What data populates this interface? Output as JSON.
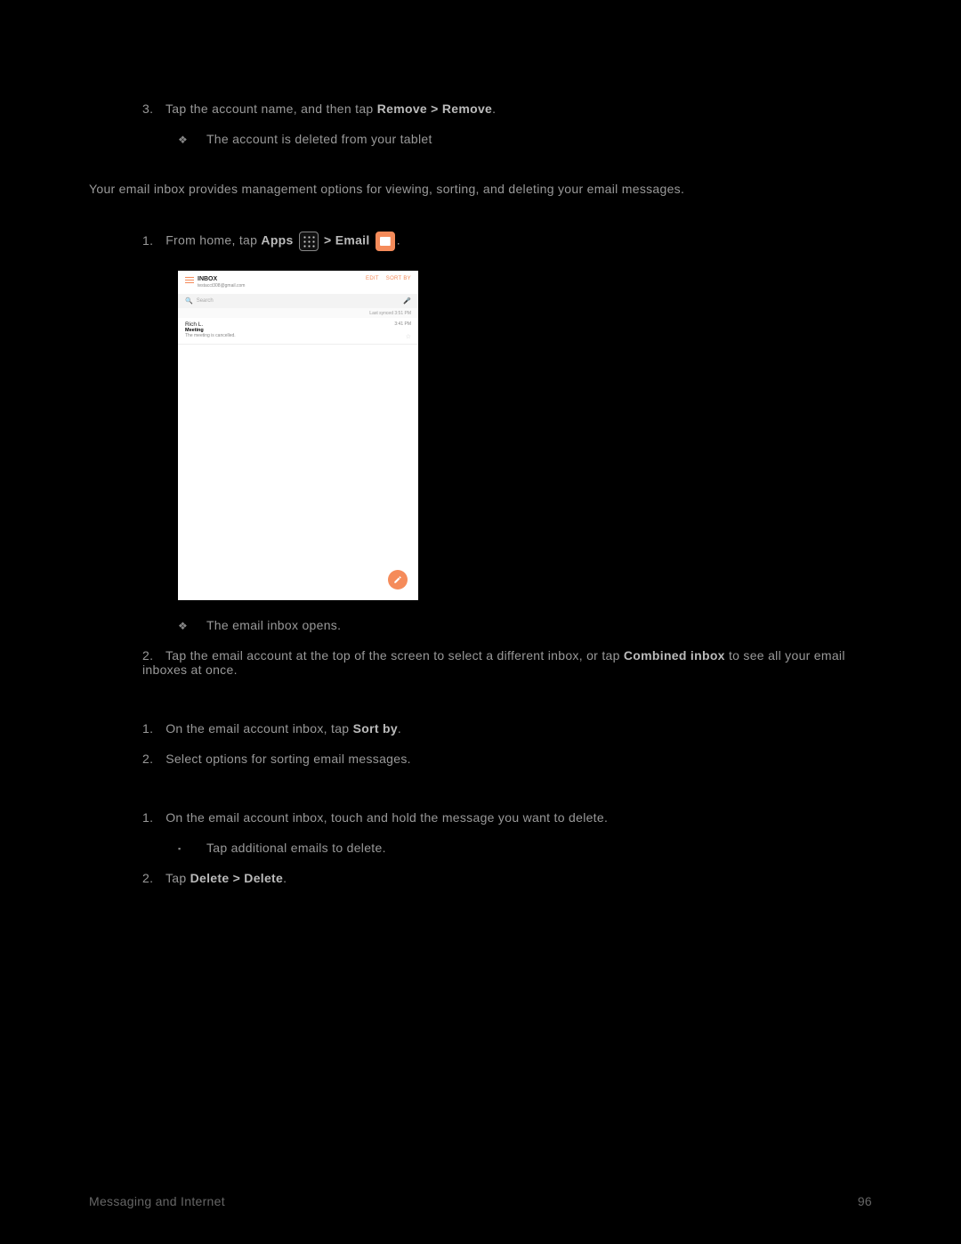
{
  "steps_top": {
    "num3": "3.",
    "line3_pre": "Tap the account name, and then tap ",
    "line3_bold": "Remove > Remove",
    "line3_post": ".",
    "result1_bullet": "❖",
    "result1": "The account is deleted from your tablet"
  },
  "intro": "Your email inbox provides management options for viewing, sorting, and deleting your email messages.",
  "open_inbox": {
    "num1": "1.",
    "pre": "From home, tap ",
    "apps": "Apps",
    "mid": " > ",
    "email": "Email",
    "post": "."
  },
  "inbox_mock": {
    "title": "INBOX",
    "account": "testacct308@gmail.com",
    "action_edit": "EDIT",
    "action_sort": "SORT BY",
    "search_placeholder": "Search",
    "last_sync": "Last synced  3:51 PM",
    "from": "Rich L.",
    "subject": "Meeting",
    "preview": "The meeting is cancelled.",
    "time": "3:41 PM"
  },
  "after_inbox": {
    "bullet": "❖",
    "opens": "The email inbox opens.",
    "num2": "2.",
    "line2_pre": "Tap the email account at the top of the screen to select a different inbox, or tap ",
    "line2_bold": "Combined inbox",
    "line2_post": " to see all your email inboxes at once."
  },
  "sort": {
    "num1": "1.",
    "line1_pre": "On the email account inbox, tap ",
    "line1_bold": "Sort by",
    "line1_post": ".",
    "num2": "2.",
    "line2": "Select options for sorting email messages."
  },
  "delete": {
    "num1": "1.",
    "line1": "On the email account inbox, touch and hold the message you want to delete.",
    "sub_bullet": "▪",
    "sub": "Tap additional emails to delete.",
    "num2": "2.",
    "line2_pre": "Tap ",
    "line2_bold": "Delete > Delete",
    "line2_post": "."
  },
  "footer": {
    "left": "Messaging and Internet",
    "right": "96"
  }
}
